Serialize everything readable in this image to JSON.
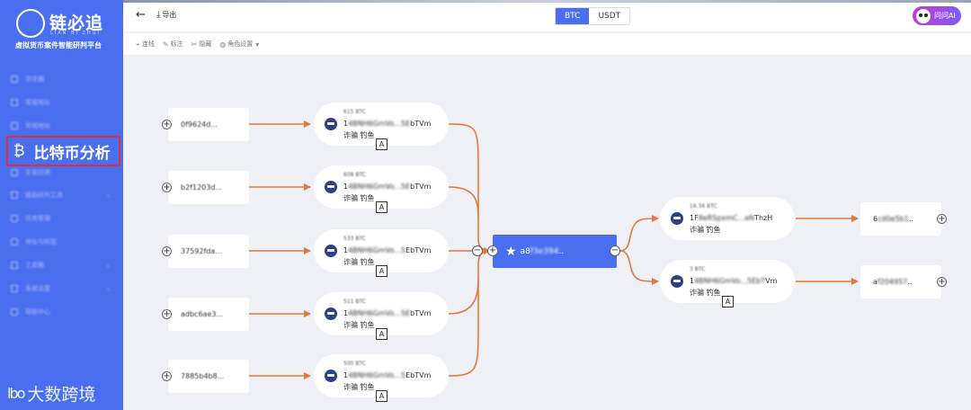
{
  "brand": {
    "name": "链必追",
    "subtitle": "LIAN BI ZHUI",
    "slogan": "虚拟货币案件智能研判平台"
  },
  "sidebar": {
    "items": [
      {
        "label": "浏览器"
      },
      {
        "label": "常规地址"
      },
      {
        "label": "常规地址"
      },
      {
        "label": "比特币分析",
        "active": true
      },
      {
        "label": "交易回溯"
      },
      {
        "label": "链路研判工具"
      },
      {
        "label": "任务管理"
      },
      {
        "label": "地址与标签"
      },
      {
        "label": "工具箱"
      },
      {
        "label": "系统设置"
      },
      {
        "label": "帮助中心"
      }
    ]
  },
  "watermark": {
    "logo": "lbo",
    "text": "大数跨境"
  },
  "topbar": {
    "back_icon": "arrow-left-icon",
    "export_label": "导出",
    "currency_tabs": [
      {
        "label": "BTC",
        "active": true
      },
      {
        "label": "USDT",
        "active": false
      }
    ],
    "ask_ai_label": "问问AI"
  },
  "toolbar": {
    "tools": [
      {
        "label": "连线",
        "icon": "link-icon"
      },
      {
        "label": "标注",
        "icon": "pencil-icon"
      },
      {
        "label": "隐藏",
        "icon": "scissors-icon"
      },
      {
        "label": "角色设置",
        "icon": "palette-icon",
        "dropdown": true
      }
    ]
  },
  "graph": {
    "sources": [
      {
        "label": "0f9624d..."
      },
      {
        "label": "b2f1203d..."
      },
      {
        "label": "37592fda..."
      },
      {
        "label": "adbc6ae3..."
      },
      {
        "label": "7885b4b8..."
      }
    ],
    "input_addresses": [
      {
        "amount": "615 BTC",
        "addr_start": "1",
        "addr_blur": "4BNH6GmVo...5E",
        "addr_end": "bTVm",
        "label": "诈骗 钓鱼",
        "tag": "A"
      },
      {
        "amount": "608 BTC",
        "addr_start": "1",
        "addr_blur": "4BNH6GmVo...5E",
        "addr_end": "bTVm",
        "label": "诈骗 钓鱼",
        "tag": "A"
      },
      {
        "amount": "533 BTC",
        "addr_start": "1",
        "addr_blur": "4BNH6GmVo...5",
        "addr_end": "EbTVm",
        "label": "诈骗 钓鱼",
        "tag": "A"
      },
      {
        "amount": "511 BTC",
        "addr_start": "1",
        "addr_blur": "4BNH6GmVo...5E",
        "addr_end": "bTVm",
        "label": "诈骗 钓鱼",
        "tag": "A"
      },
      {
        "amount": "500 BTC",
        "addr_start": "1",
        "addr_blur": "4BNH6GmVo...5",
        "addr_end": "EbTVm",
        "label": "诈骗 钓鱼",
        "tag": "A"
      }
    ],
    "center": {
      "prefix": "a8",
      "blur": "f3e394",
      "suffix": ".."
    },
    "output_addresses": [
      {
        "amount": "16.36 BTC",
        "addr_start": "1F",
        "addr_blur": "8eRSpxmC...aN",
        "addr_end": "ThzH",
        "label": "诈骗 钓鱼",
        "tag": ""
      },
      {
        "amount": "3 BTC",
        "addr_start": "1",
        "addr_blur": "4BNH6GmVo...5EbT",
        "addr_end": "Vm",
        "label": "诈骗 钓鱼",
        "tag": "A"
      }
    ],
    "destinations": [
      {
        "prefix": "6",
        "blur": "cd0e5b1",
        "suffix": ".."
      },
      {
        "prefix": "a",
        "blur": "f204957",
        "suffix": ".."
      }
    ]
  },
  "colors": {
    "accent": "#4a6ef0",
    "edge": "#e07a3c",
    "highlight": "#e0303c"
  }
}
